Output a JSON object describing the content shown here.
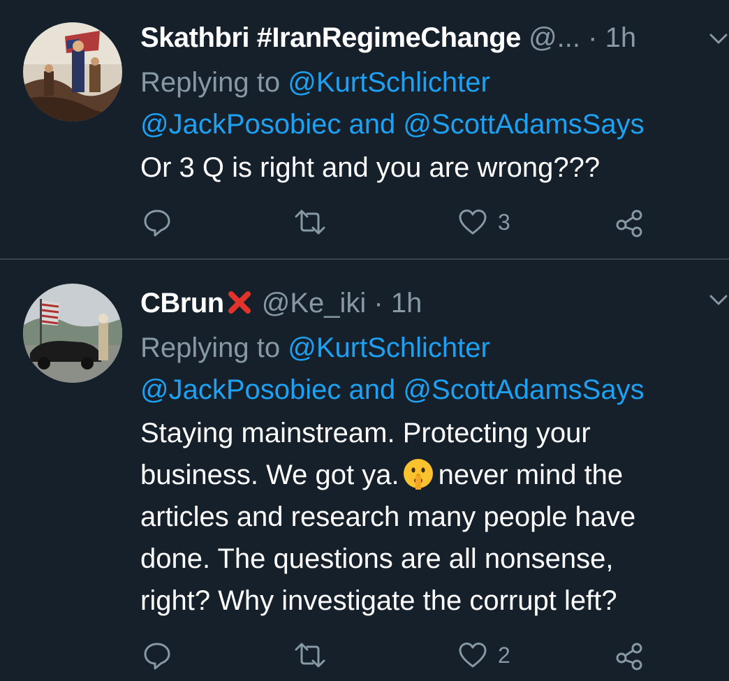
{
  "tweets": [
    {
      "display_name": "Skathbri #IranRegimeChange",
      "handle": "@...",
      "separator": "·",
      "timestamp": "1h",
      "reply_prefix": "Replying to",
      "reply_mention_1": "@KurtSchlichter",
      "reply_mention_2": "@JackPosobiec",
      "reply_and": "and",
      "reply_mention_3": "@ScottAdamsSays",
      "body_lines": [
        "Or 3 Q is right and you are wrong???"
      ],
      "like_count": "3",
      "avatar_icon": "revolutionary-painting-avatar"
    },
    {
      "display_name": "CBrun",
      "name_badge_icon": "red-x-icon",
      "handle": "@Ke_iki",
      "separator": "·",
      "timestamp": "1h",
      "reply_prefix": "Replying to",
      "reply_mention_1": "@KurtSchlichter",
      "reply_mention_2": "@JackPosobiec",
      "reply_and": "and",
      "reply_mention_3": "@ScottAdamsSays",
      "body_line_1": "Staying mainstream. Protecting your",
      "body_line_2_before": "business. We got ya.",
      "body_line_2_emoji": "shushing-face-emoji",
      "body_line_2_after": "never mind the",
      "body_line_3": "articles and research many people have",
      "body_line_4": "done. The questions are all nonsense,",
      "body_line_5": "right? Why investigate the corrupt left?",
      "like_count": "2",
      "avatar_icon": "car-and-washington-avatar"
    }
  ],
  "colors": {
    "background": "#15202b",
    "divider": "#38444d",
    "text_primary": "#ffffff",
    "text_secondary": "#8899a6",
    "link": "#1da1f2"
  }
}
